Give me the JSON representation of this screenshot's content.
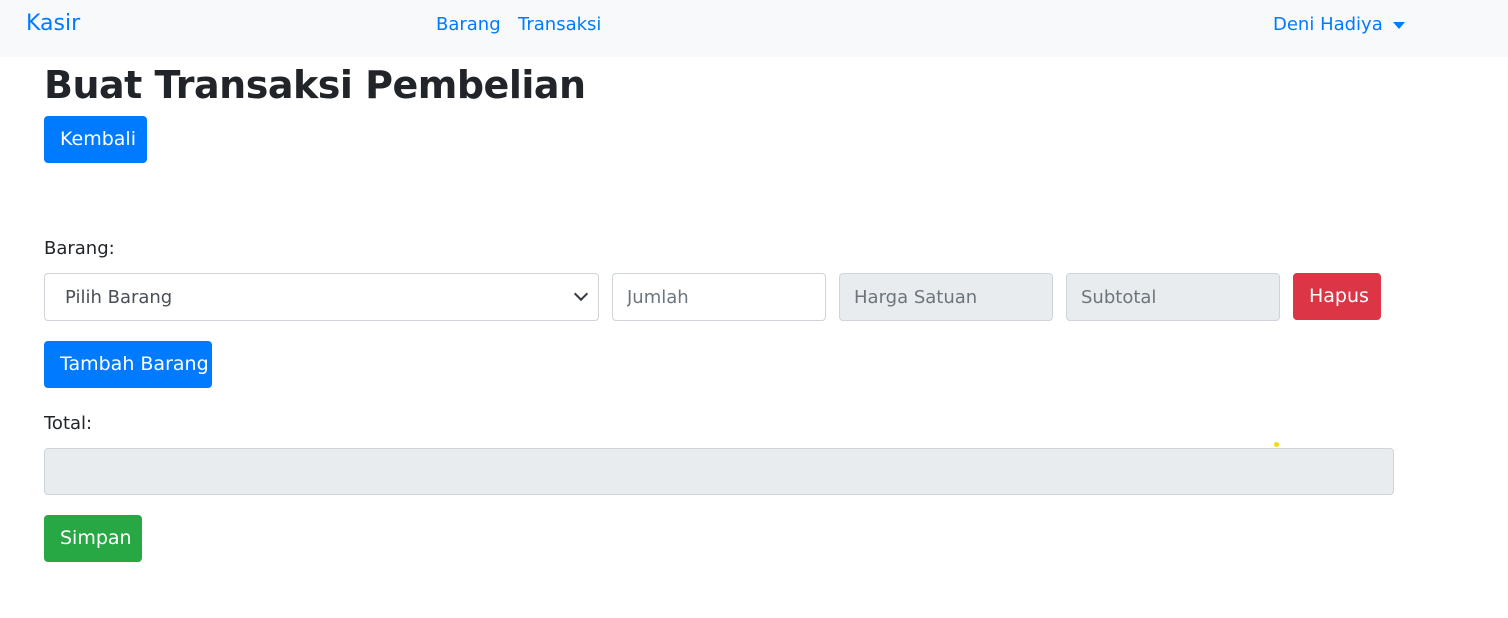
{
  "navbar": {
    "brand": "Kasir",
    "links": [
      "Barang",
      "Transaksi"
    ],
    "user": "Deni Hadiya"
  },
  "page": {
    "title": "Buat Transaksi Pembelian"
  },
  "buttons": {
    "back_label": "Kembali",
    "add_item_label": "Tambah Barang",
    "delete_label": "Hapus",
    "save_label": "Simpan"
  },
  "form": {
    "item_label": "Barang:",
    "item_select_value": "Pilih Barang",
    "qty_placeholder": "Jumlah",
    "unit_price_placeholder": "Harga Satuan",
    "subtotal_placeholder": "Subtotal",
    "total_label": "Total:",
    "total_value": ""
  },
  "colors": {
    "primary": "#007bff",
    "danger": "#dc3545",
    "success": "#28a745",
    "readonly_bg": "#e9ecef",
    "navbar_bg": "#f8f9fa"
  }
}
